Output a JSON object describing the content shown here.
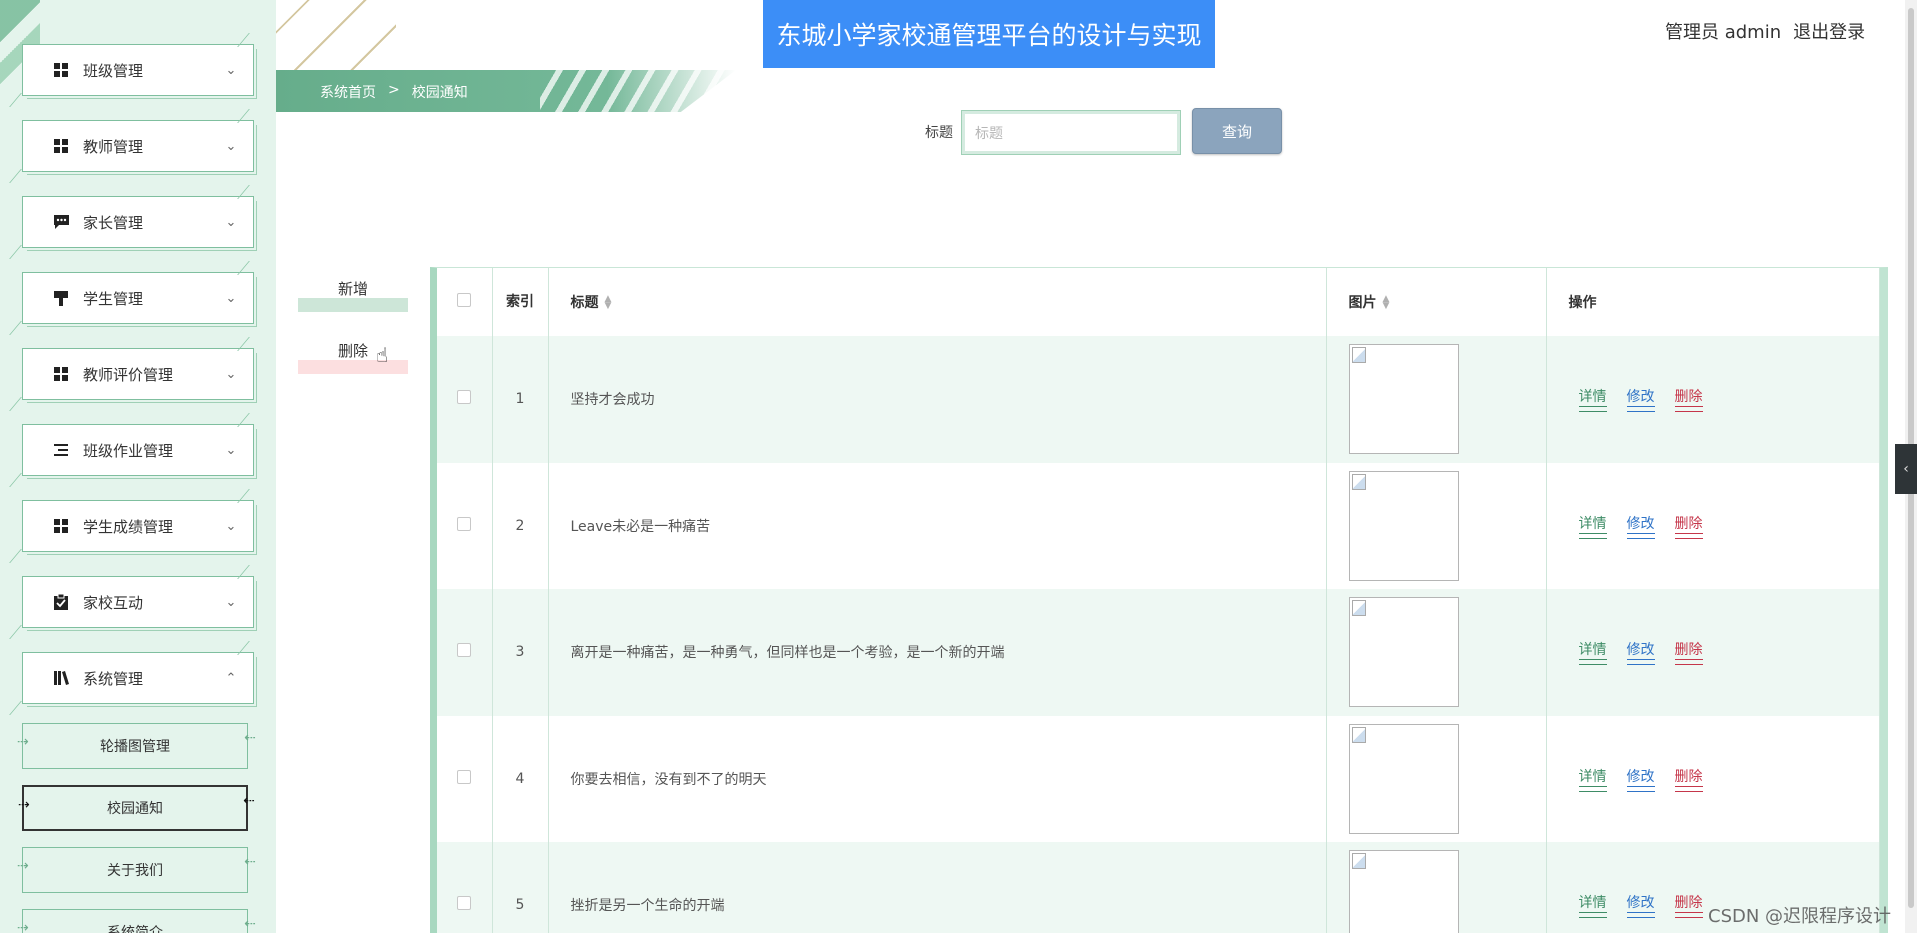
{
  "app_title": "东城小学家校通管理平台的设计与实现",
  "user": {
    "label": "管理员 admin",
    "logout": "退出登录"
  },
  "breadcrumb": {
    "home": "系统首页",
    "separator": ">",
    "current": "校园通知"
  },
  "sidebar": {
    "items": [
      {
        "label": "班级管理",
        "icon": "grid-icon",
        "expanded": false
      },
      {
        "label": "教师管理",
        "icon": "grid-icon",
        "expanded": false
      },
      {
        "label": "家长管理",
        "icon": "chat-icon",
        "expanded": false
      },
      {
        "label": "学生管理",
        "icon": "pin-icon",
        "expanded": false
      },
      {
        "label": "教师评价管理",
        "icon": "grid-icon",
        "expanded": false
      },
      {
        "label": "班级作业管理",
        "icon": "list-icon",
        "expanded": false
      },
      {
        "label": "学生成绩管理",
        "icon": "grid-icon",
        "expanded": false
      },
      {
        "label": "家校互动",
        "icon": "clipboard-icon",
        "expanded": false
      },
      {
        "label": "系统管理",
        "icon": "books-icon",
        "expanded": true
      }
    ],
    "sub_items": [
      {
        "label": "轮播图管理",
        "active": false
      },
      {
        "label": "校园通知",
        "active": true
      },
      {
        "label": "关于我们",
        "active": false
      },
      {
        "label": "系统简介",
        "active": false
      }
    ]
  },
  "search": {
    "label": "标题",
    "placeholder": "标题",
    "value": "",
    "button": "查询"
  },
  "actions": {
    "add": "新增",
    "delete": "删除"
  },
  "table": {
    "headers": {
      "index": "索引",
      "title": "标题",
      "image": "图片",
      "operation": "操作"
    },
    "rows": [
      {
        "index": "1",
        "title": "坚持才会成功"
      },
      {
        "index": "2",
        "title": "Leave未必是一种痛苦"
      },
      {
        "index": "3",
        "title": "离开是一种痛苦，是一种勇气，但同样也是一个考验，是一个新的开端"
      },
      {
        "index": "4",
        "title": "你要去相信，没有到不了的明天"
      },
      {
        "index": "5",
        "title": "挫折是另一个生命的开端"
      }
    ],
    "ops": {
      "detail": "详情",
      "edit": "修改",
      "delete": "删除"
    }
  },
  "colors": {
    "accent": "#66ad8b",
    "title_bg": "#3c8ef7",
    "search_btn": "#8ba4bd",
    "op_detail": "#3e8c66",
    "op_edit": "#2f73c7",
    "op_delete": "#c5364a"
  },
  "watermark": "CSDN @迟限程序设计"
}
